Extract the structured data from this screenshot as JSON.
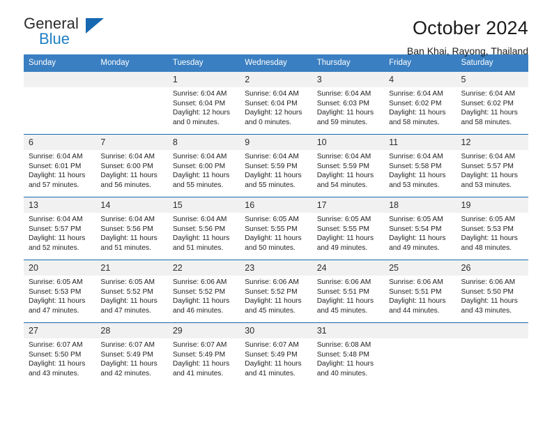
{
  "brand": {
    "name_top": "General",
    "name_bottom": "Blue",
    "accent_color": "#1668b0",
    "text_color": "#2b2b2b"
  },
  "header": {
    "title": "October 2024",
    "subtitle": "Ban Khai, Rayong, Thailand"
  },
  "calendar": {
    "header_bg": "#3a7fc1",
    "daynum_bg": "#f1f1f1",
    "row_border": "#1668b0",
    "weekdays": [
      "Sunday",
      "Monday",
      "Tuesday",
      "Wednesday",
      "Thursday",
      "Friday",
      "Saturday"
    ],
    "weeks": [
      [
        {
          "day": "",
          "lines": []
        },
        {
          "day": "",
          "lines": []
        },
        {
          "day": "1",
          "lines": [
            "Sunrise: 6:04 AM",
            "Sunset: 6:04 PM",
            "Daylight: 12 hours",
            "and 0 minutes."
          ]
        },
        {
          "day": "2",
          "lines": [
            "Sunrise: 6:04 AM",
            "Sunset: 6:04 PM",
            "Daylight: 12 hours",
            "and 0 minutes."
          ]
        },
        {
          "day": "3",
          "lines": [
            "Sunrise: 6:04 AM",
            "Sunset: 6:03 PM",
            "Daylight: 11 hours",
            "and 59 minutes."
          ]
        },
        {
          "day": "4",
          "lines": [
            "Sunrise: 6:04 AM",
            "Sunset: 6:02 PM",
            "Daylight: 11 hours",
            "and 58 minutes."
          ]
        },
        {
          "day": "5",
          "lines": [
            "Sunrise: 6:04 AM",
            "Sunset: 6:02 PM",
            "Daylight: 11 hours",
            "and 58 minutes."
          ]
        }
      ],
      [
        {
          "day": "6",
          "lines": [
            "Sunrise: 6:04 AM",
            "Sunset: 6:01 PM",
            "Daylight: 11 hours",
            "and 57 minutes."
          ]
        },
        {
          "day": "7",
          "lines": [
            "Sunrise: 6:04 AM",
            "Sunset: 6:00 PM",
            "Daylight: 11 hours",
            "and 56 minutes."
          ]
        },
        {
          "day": "8",
          "lines": [
            "Sunrise: 6:04 AM",
            "Sunset: 6:00 PM",
            "Daylight: 11 hours",
            "and 55 minutes."
          ]
        },
        {
          "day": "9",
          "lines": [
            "Sunrise: 6:04 AM",
            "Sunset: 5:59 PM",
            "Daylight: 11 hours",
            "and 55 minutes."
          ]
        },
        {
          "day": "10",
          "lines": [
            "Sunrise: 6:04 AM",
            "Sunset: 5:59 PM",
            "Daylight: 11 hours",
            "and 54 minutes."
          ]
        },
        {
          "day": "11",
          "lines": [
            "Sunrise: 6:04 AM",
            "Sunset: 5:58 PM",
            "Daylight: 11 hours",
            "and 53 minutes."
          ]
        },
        {
          "day": "12",
          "lines": [
            "Sunrise: 6:04 AM",
            "Sunset: 5:57 PM",
            "Daylight: 11 hours",
            "and 53 minutes."
          ]
        }
      ],
      [
        {
          "day": "13",
          "lines": [
            "Sunrise: 6:04 AM",
            "Sunset: 5:57 PM",
            "Daylight: 11 hours",
            "and 52 minutes."
          ]
        },
        {
          "day": "14",
          "lines": [
            "Sunrise: 6:04 AM",
            "Sunset: 5:56 PM",
            "Daylight: 11 hours",
            "and 51 minutes."
          ]
        },
        {
          "day": "15",
          "lines": [
            "Sunrise: 6:04 AM",
            "Sunset: 5:56 PM",
            "Daylight: 11 hours",
            "and 51 minutes."
          ]
        },
        {
          "day": "16",
          "lines": [
            "Sunrise: 6:05 AM",
            "Sunset: 5:55 PM",
            "Daylight: 11 hours",
            "and 50 minutes."
          ]
        },
        {
          "day": "17",
          "lines": [
            "Sunrise: 6:05 AM",
            "Sunset: 5:55 PM",
            "Daylight: 11 hours",
            "and 49 minutes."
          ]
        },
        {
          "day": "18",
          "lines": [
            "Sunrise: 6:05 AM",
            "Sunset: 5:54 PM",
            "Daylight: 11 hours",
            "and 49 minutes."
          ]
        },
        {
          "day": "19",
          "lines": [
            "Sunrise: 6:05 AM",
            "Sunset: 5:53 PM",
            "Daylight: 11 hours",
            "and 48 minutes."
          ]
        }
      ],
      [
        {
          "day": "20",
          "lines": [
            "Sunrise: 6:05 AM",
            "Sunset: 5:53 PM",
            "Daylight: 11 hours",
            "and 47 minutes."
          ]
        },
        {
          "day": "21",
          "lines": [
            "Sunrise: 6:05 AM",
            "Sunset: 5:52 PM",
            "Daylight: 11 hours",
            "and 47 minutes."
          ]
        },
        {
          "day": "22",
          "lines": [
            "Sunrise: 6:06 AM",
            "Sunset: 5:52 PM",
            "Daylight: 11 hours",
            "and 46 minutes."
          ]
        },
        {
          "day": "23",
          "lines": [
            "Sunrise: 6:06 AM",
            "Sunset: 5:52 PM",
            "Daylight: 11 hours",
            "and 45 minutes."
          ]
        },
        {
          "day": "24",
          "lines": [
            "Sunrise: 6:06 AM",
            "Sunset: 5:51 PM",
            "Daylight: 11 hours",
            "and 45 minutes."
          ]
        },
        {
          "day": "25",
          "lines": [
            "Sunrise: 6:06 AM",
            "Sunset: 5:51 PM",
            "Daylight: 11 hours",
            "and 44 minutes."
          ]
        },
        {
          "day": "26",
          "lines": [
            "Sunrise: 6:06 AM",
            "Sunset: 5:50 PM",
            "Daylight: 11 hours",
            "and 43 minutes."
          ]
        }
      ],
      [
        {
          "day": "27",
          "lines": [
            "Sunrise: 6:07 AM",
            "Sunset: 5:50 PM",
            "Daylight: 11 hours",
            "and 43 minutes."
          ]
        },
        {
          "day": "28",
          "lines": [
            "Sunrise: 6:07 AM",
            "Sunset: 5:49 PM",
            "Daylight: 11 hours",
            "and 42 minutes."
          ]
        },
        {
          "day": "29",
          "lines": [
            "Sunrise: 6:07 AM",
            "Sunset: 5:49 PM",
            "Daylight: 11 hours",
            "and 41 minutes."
          ]
        },
        {
          "day": "30",
          "lines": [
            "Sunrise: 6:07 AM",
            "Sunset: 5:49 PM",
            "Daylight: 11 hours",
            "and 41 minutes."
          ]
        },
        {
          "day": "31",
          "lines": [
            "Sunrise: 6:08 AM",
            "Sunset: 5:48 PM",
            "Daylight: 11 hours",
            "and 40 minutes."
          ]
        },
        {
          "day": "",
          "lines": []
        },
        {
          "day": "",
          "lines": []
        }
      ]
    ]
  }
}
